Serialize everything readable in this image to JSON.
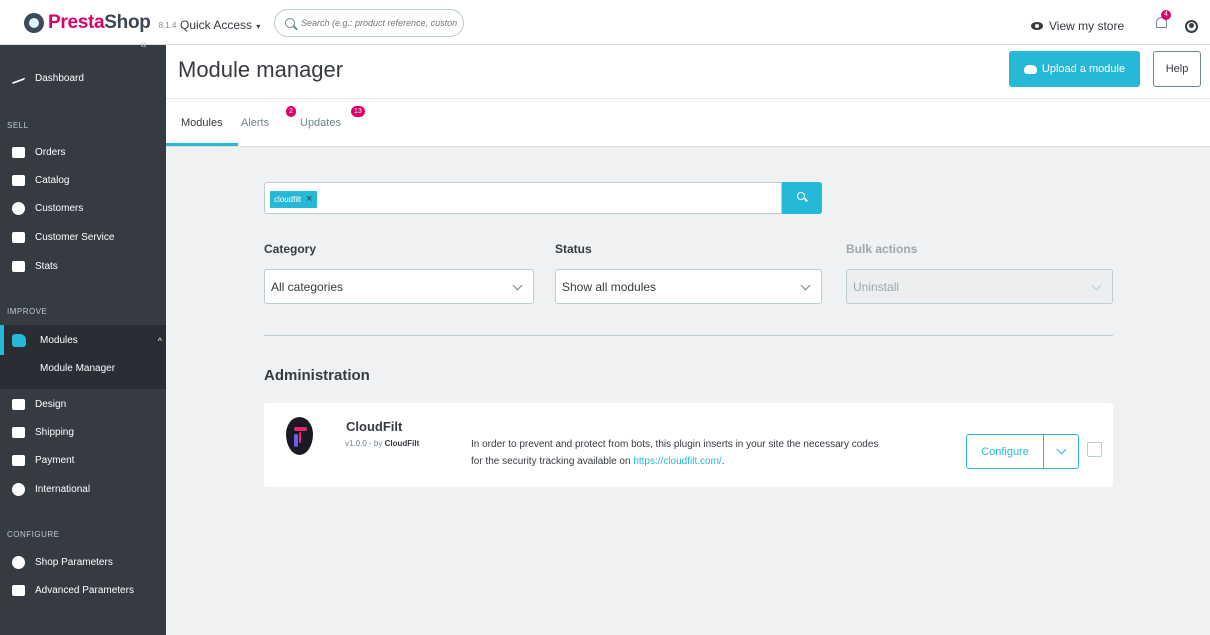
{
  "topbar": {
    "logo_brand_a": "Presta",
    "logo_brand_b": "Shop",
    "version": "8.1.4",
    "quick_access": "Quick Access",
    "search_placeholder": "Search (e.g.: product reference, custon",
    "view_store": "View my store",
    "notifications_count": "4"
  },
  "sidebar": {
    "items": [
      {
        "label": "Dashboard",
        "icon": "trend-icon"
      },
      {
        "label": "Orders",
        "icon": "basket-icon"
      },
      {
        "label": "Catalog",
        "icon": "store-icon"
      },
      {
        "label": "Customers",
        "icon": "user-icon"
      },
      {
        "label": "Customer Service",
        "icon": "chat-icon"
      },
      {
        "label": "Stats",
        "icon": "chart-icon"
      },
      {
        "label": "Modules",
        "icon": "puzzle-icon"
      },
      {
        "label": "Module Manager"
      },
      {
        "label": "Design",
        "icon": "monitor-icon"
      },
      {
        "label": "Shipping",
        "icon": "truck-icon"
      },
      {
        "label": "Payment",
        "icon": "card-icon"
      },
      {
        "label": "International",
        "icon": "globe-icon"
      },
      {
        "label": "Shop Parameters",
        "icon": "gear-icon"
      },
      {
        "label": "Advanced Parameters",
        "icon": "settings-box-icon"
      }
    ],
    "sections": [
      "SELL",
      "IMPROVE",
      "CONFIGURE"
    ]
  },
  "header": {
    "title": "Module manager",
    "upload_label": "Upload a module",
    "help_label": "Help",
    "tabs": [
      {
        "label": "Modules"
      },
      {
        "label": "Alerts",
        "badge": "2"
      },
      {
        "label": "Updates",
        "badge": "13"
      }
    ]
  },
  "filters": {
    "search_chip": "cloudfilt",
    "category_label": "Category",
    "category_value": "All categories",
    "status_label": "Status",
    "status_value": "Show all modules",
    "bulk_label": "Bulk actions",
    "bulk_value": "Uninstall"
  },
  "section": {
    "title": "Administration"
  },
  "module": {
    "name": "CloudFilt",
    "version_prefix": "v1.0.0 - by",
    "author": "CloudFilt",
    "description": "In order to prevent and protect from bots, this plugin inserts in your site the necessary codes for the security tracking available on",
    "link": "https://cloudfilt.com/",
    "link_suffix": ".",
    "configure_label": "Configure"
  },
  "colors": {
    "accent": "#25b9d7",
    "sidebar": "#363a41",
    "brand_pink": "#df0067"
  }
}
